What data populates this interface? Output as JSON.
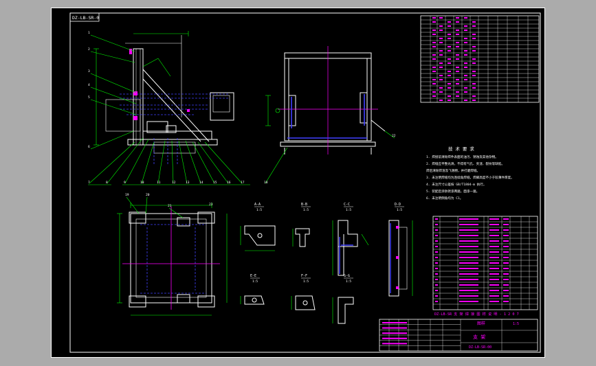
{
  "colors": {
    "viewport_bg": "#ababab",
    "sheet_bg": "#000000",
    "frame": "#ffffff",
    "table": "#ffffff",
    "text_table": "#ff00ff",
    "notes": "#ffffff",
    "leader": "#00ff00",
    "hidden": "#0000ff",
    "centerline": "#ff00ff",
    "marker": "#ff00ff"
  },
  "sheet": {
    "stamp_label": "DZ-LB-SR-0"
  },
  "views": {
    "section_labels": [
      "A-A",
      "B-B",
      "C-C",
      "D-D",
      "E-E",
      "F-F",
      "G-G"
    ],
    "section_scales": [
      "1:5",
      "1:5",
      "1:5",
      "1:5",
      "1:5",
      "1:5",
      "1:5"
    ],
    "balloon_numbers": [
      "1",
      "2",
      "3",
      "4",
      "5",
      "6",
      "7",
      "8",
      "9",
      "10",
      "11",
      "12",
      "13",
      "14",
      "15",
      "16",
      "17",
      "18",
      "19",
      "20",
      "21",
      "22",
      "23"
    ]
  },
  "notes": {
    "title": "技 术 要 求",
    "lines": [
      "1. 焊接前清除焊件表面的油污、锈蚀及其他杂物。",
      "2. 焊缝应平整光滑，不得有气孔、夹渣、裂纹等缺陷。",
      "   焊后清除焊渣及飞溅物，并打磨焊缝。",
      "3. 未注明焊缝均为连续角焊缝，焊脚高度不小于较薄件厚度。",
      "4. 未注尺寸公差按 GB/T1804-m 执行。",
      "5. 装配后涂防锈漆两遍，面漆一遍。",
      "6. 未注明倒角均为 C1。"
    ]
  },
  "title_block": {
    "drawing_name": "支 架",
    "drawing_number": "DZ-LB-SR-00",
    "company": "图样",
    "scale": "1:5",
    "mid_caption": "DZ-LB-SR 支 架 焊 接 图 样 说 明 - 1 2 0 7"
  }
}
